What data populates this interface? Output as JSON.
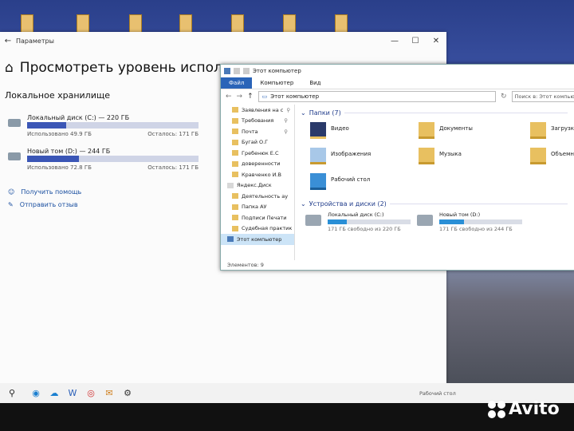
{
  "settings": {
    "title": "Параметры",
    "back": "←",
    "minimize": "—",
    "maximize": "☐",
    "close": "✕",
    "heading": "Просмотреть уровень использован",
    "home_icon": "home-icon",
    "subheading": "Локальное хранилище",
    "drives": [
      {
        "name": "Локальный диск (C:) — 220 ГБ",
        "used": "Использовано 49.9 ГБ",
        "free": "Осталось: 171 ГБ",
        "fill": 0.23
      },
      {
        "name": "Новый том (D:) — 244 ГБ",
        "used": "Использовано 72.8 ГБ",
        "free": "Осталось: 171 ГБ",
        "fill": 0.3
      }
    ],
    "help": "Получить помощь",
    "feedback": "Отправить отзыв"
  },
  "explorer": {
    "title": "Этот компьютер",
    "tabs": [
      "Файл",
      "Компьютер",
      "Вид"
    ],
    "path": "Этот компьютер",
    "search_placeholder": "Поиск в: Этот компьютер",
    "nav_items": [
      {
        "label": "Заявления на с"
      },
      {
        "label": "Требования"
      },
      {
        "label": "Почта"
      },
      {
        "label": "Бугай О.Г"
      },
      {
        "label": "Гребенюк Е.С"
      },
      {
        "label": "доверенности"
      },
      {
        "label": "Кравченко И.В"
      },
      {
        "label": "Яндекс.Диск"
      },
      {
        "label": "Деятельность ау"
      },
      {
        "label": "Папка АУ"
      },
      {
        "label": "Подписи Печати"
      },
      {
        "label": "Судебная практик"
      },
      {
        "label": "Этот компьютер"
      }
    ],
    "folders_group": "Папки (7)",
    "folders": [
      "Видео",
      "Документы",
      "Загрузки",
      "Изображения",
      "Музыка",
      "Объемные",
      "Рабочий стол"
    ],
    "devices_group": "Устройства и диски (2)",
    "devices": [
      {
        "name": "Локальный диск (C:)",
        "free": "171 ГБ свободно из 220 ГБ",
        "fill": 0.23
      },
      {
        "name": "Новый том (D:)",
        "free": "171 ГБ свободно из 244 ГБ",
        "fill": 0.3
      }
    ],
    "status": "Элементов: 9"
  },
  "taskbar": {
    "desktop_label": "Рабочий стол"
  },
  "watermark": "Avito"
}
